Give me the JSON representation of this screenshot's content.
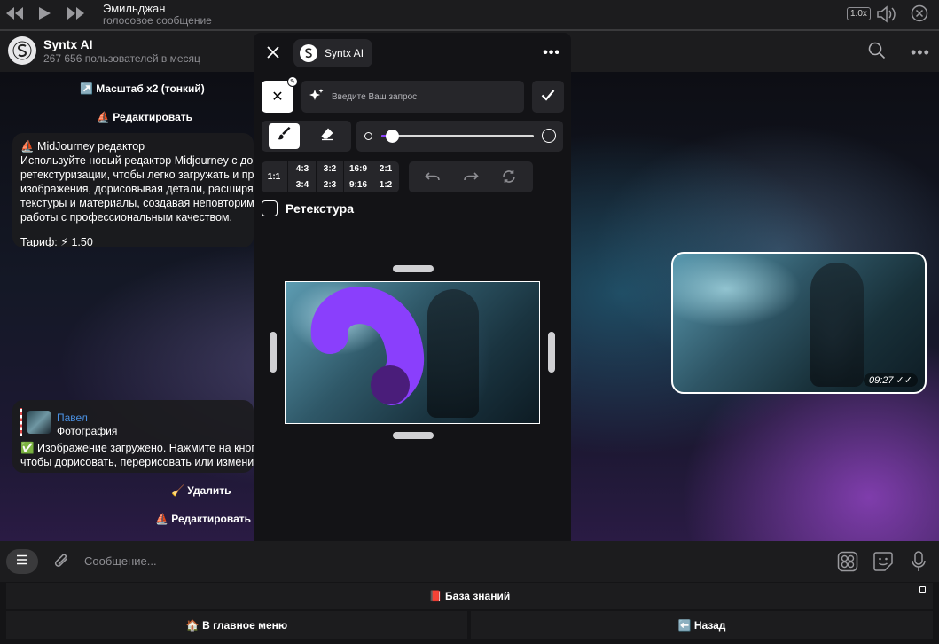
{
  "player": {
    "title": "Эмильджан",
    "subtitle": "голосовое сообщение",
    "speed": "1.0x"
  },
  "chat": {
    "name": "Syntx AI",
    "members": "267 656 пользователей в месяц"
  },
  "messages": {
    "scale_button": "↗️ Масштаб x2 (тонкий)",
    "edit_button_top": "⛵ Редактировать",
    "mj_title": "⛵ MidJourney редактор",
    "mj_lines": [
      "Используйте новый редактор Midjourney с доп",
      "ретекстуризации, чтобы легко загружать и пр",
      "изображения, дорисовывая детали, расширя",
      "текстуры и материалы, создавая неповторимь",
      "работы с профессиональным качеством."
    ],
    "tariff": "Тариф: ⚡ 1.50",
    "reply_name": "Павел",
    "reply_sub": "Фотография",
    "upload_line1": "✅ Изображение загружено. Нажмите на кноп",
    "upload_line2": "чтобы дорисовать, перерисовать или изменит",
    "delete_button": "🧹 Удалить",
    "edit_button_bottom": "⛵ Редактировать",
    "image_time": "09:27 ✓✓"
  },
  "editor": {
    "brand": "Syntx AI",
    "prompt_placeholder": "Введите Ваш запрос",
    "brush_size": 0.07,
    "ratios_top": [
      "4:3",
      "3:2",
      "16:9",
      "2:1"
    ],
    "ratios_bottom": [
      "3:4",
      "2:3",
      "9:16",
      "1:2"
    ],
    "ratio_square": "1:1",
    "retexture_label": "Ретекстура",
    "retexture_checked": false,
    "mask_color": "#8a3ffc"
  },
  "composer": {
    "placeholder": "Сообщение..."
  },
  "keyboard": {
    "knowledge_base": "📕 База знаний",
    "main_menu": "🏠 В главное меню",
    "back": "⬅️ Назад"
  },
  "colors": {
    "accent": "#8a3ffc",
    "link": "#4a90e2"
  }
}
